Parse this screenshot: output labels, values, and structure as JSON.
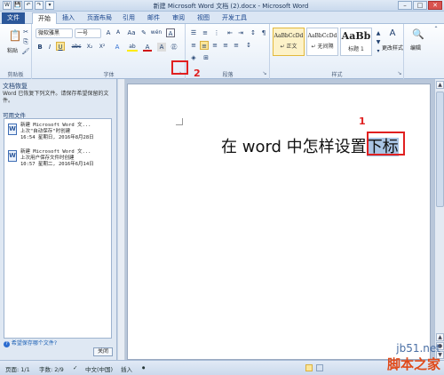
{
  "window": {
    "title": "新建 Microsoft Word 文档 (2).docx - Microsoft Word",
    "qat": [
      "W",
      "💾",
      "↶",
      "↷",
      "▾"
    ],
    "controls": {
      "minimize": "–",
      "maximize": "□",
      "close": "✕"
    }
  },
  "tabs": [
    "文件",
    "开始",
    "插入",
    "页面布局",
    "引用",
    "邮件",
    "审阅",
    "视图",
    "开发工具"
  ],
  "ribbon": {
    "clipboard": {
      "paste": "粘贴",
      "label": "剪贴板"
    },
    "font": {
      "name": "微软雅黑",
      "size": "一号",
      "grow": "A",
      "shrink": "A",
      "case": "Aa",
      "clear": "✎",
      "phonetic": "wén",
      "bold": "B",
      "italic": "I",
      "underline": "U",
      "strike": "abc",
      "sub": "X₂",
      "sup": "X²",
      "effects": "A",
      "highlight": "ab",
      "color": "A",
      "label": "字体",
      "launcher": "↘"
    },
    "paragraph": {
      "label": "段落",
      "launcher": "↘"
    },
    "styles": {
      "items": [
        {
          "sample": "AaBbCcDd",
          "name": "↵ 正文"
        },
        {
          "sample": "AaBbCcDd",
          "name": "↵ 无间隔"
        },
        {
          "sample": "AaBb",
          "name": "标题 1"
        }
      ],
      "change_styles": "更改样式",
      "label": "样式"
    },
    "editing": {
      "label": "编辑"
    }
  },
  "annotations": {
    "step1": "1",
    "step2": "2"
  },
  "recovery_pane": {
    "title": "文档恢复",
    "description": "Word 已恢复下列文件。请保存希望保留的文件。",
    "available": "可用文件",
    "files": [
      {
        "name": "新建 Microsoft Word 文...",
        "line2": "上次\"自动保存\"时创建",
        "line3": "16:54 星期日, 2016年8月28日"
      },
      {
        "name": "新建 Microsoft Word 文...",
        "line2": "上次用户保存文件时创建",
        "line3": "10:57 星期二, 2016年6月14日"
      }
    ],
    "which_link": "希望保存哪个文件?",
    "close": "关闭"
  },
  "document": {
    "text_before": "在 word 中怎样设置",
    "text_selected": "下标"
  },
  "status": {
    "page": "页面: 1/1",
    "words": "字数: 2/9",
    "language": "中文(中国)",
    "mode": "插入"
  },
  "watermark": {
    "site": "jb51.net",
    "brand": "脚本之家"
  },
  "colors": {
    "file_tab": "#2b579a",
    "annotation": "#e02020",
    "selection": "#a9c4e4"
  }
}
